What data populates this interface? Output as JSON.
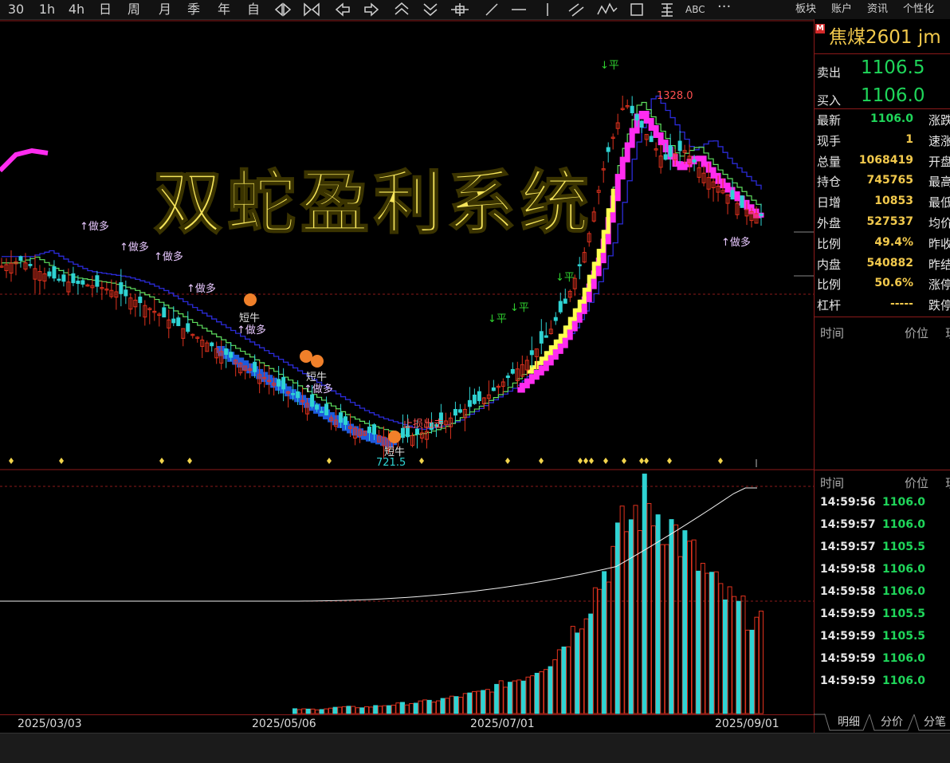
{
  "toolbar": {
    "periods": [
      "30",
      "1h",
      "4h",
      "日",
      "周",
      "月",
      "季",
      "年",
      "自"
    ],
    "tool_icons": [
      "zoom-out-icon",
      "zoom-in-icon",
      "arrow-left-icon",
      "arrow-right-icon",
      "arrow-up-icon",
      "arrow-down-icon",
      "crosshair-icon",
      "trendline-icon",
      "horizontal-line-icon",
      "vertical-line-icon",
      "parallel-line-icon",
      "wave-icon",
      "rectangle-icon",
      "fib-icon"
    ],
    "abc": "ABC",
    "more": "···",
    "menus": [
      "板块",
      "账户",
      "资讯",
      "个性化"
    ]
  },
  "overlay_title": "双蛇盈利系统",
  "annotations": {
    "up_signal": "↑做多",
    "down_signal": "↓平",
    "short_bull": "短牛",
    "peak_label": "1328.0",
    "low_label": "721.5",
    "middle_text": "止损出击"
  },
  "xaxis": {
    "dates": [
      "2025/03/03",
      "2025/05/06",
      "2025/07/01",
      "2025/09/01"
    ]
  },
  "quote": {
    "badge": "M",
    "symbol": "焦煤2601",
    "code": "jm",
    "sell_label": "卖出",
    "sell_value": "1106.5",
    "buy_label": "买入",
    "buy_value": "1106.0",
    "rows": [
      {
        "label": "最新",
        "value": "1106.0",
        "color": "#1fd65a",
        "right": "涨跌"
      },
      {
        "label": "现手",
        "value": "1",
        "color": "#f2c94c",
        "right": "速涨"
      },
      {
        "label": "总量",
        "value": "1068419",
        "color": "#f2c94c",
        "right": "开盘"
      },
      {
        "label": "持仓",
        "value": "745765",
        "color": "#f2c94c",
        "right": "最高"
      },
      {
        "label": "日增",
        "value": "10853",
        "color": "#f2c94c",
        "right": "最低"
      },
      {
        "label": "外盘",
        "value": "527537",
        "color": "#f2c94c",
        "right": "均价"
      },
      {
        "label": "比例",
        "value": "49.4%",
        "color": "#f2c94c",
        "right": "昨收"
      },
      {
        "label": "内盘",
        "value": "540882",
        "color": "#f2c94c",
        "right": "昨结"
      },
      {
        "label": "比例",
        "value": "50.6%",
        "color": "#f2c94c",
        "right": "涨停"
      },
      {
        "label": "杠杆",
        "value": "-----",
        "color": "#f2c94c",
        "right": "跌停"
      }
    ],
    "tick_header_1": {
      "time": "时间",
      "price": "价位",
      "vol": "现"
    },
    "tick_header_2": {
      "time": "时间",
      "price": "价位",
      "vol": "现"
    },
    "ticks": [
      {
        "time": "14:59:56",
        "price": "1106.0"
      },
      {
        "time": "14:59:57",
        "price": "1106.0"
      },
      {
        "time": "14:59:57",
        "price": "1105.5"
      },
      {
        "time": "14:59:58",
        "price": "1106.0"
      },
      {
        "time": "14:59:58",
        "price": "1106.0"
      },
      {
        "time": "14:59:59",
        "price": "1105.5"
      },
      {
        "time": "14:59:59",
        "price": "1105.5"
      },
      {
        "time": "14:59:59",
        "price": "1106.0"
      },
      {
        "time": "14:59:59",
        "price": "1106.0"
      }
    ],
    "tabs": [
      "明细",
      "分价",
      "分笔"
    ]
  },
  "colors": {
    "up": "#e0321e",
    "down": "#2fd3d3",
    "magenta": "#ff2cf0",
    "yellow": "#ffff50",
    "blue": "#1e5adc",
    "green_line": "#5fe05f",
    "navy_line": "#2b2bd8",
    "grid": "#8b1a1a"
  },
  "chart_data": {
    "type": "candlestick",
    "x_start": "2025/02",
    "x_end": "2025/09",
    "price_labels": {
      "high": 1328.0,
      "low": 721.5
    },
    "close_path": [
      1020,
      1030,
      1010,
      995,
      990,
      985,
      975,
      960,
      940,
      920,
      900,
      880,
      860,
      840,
      820,
      800,
      780,
      760,
      745,
      735,
      725,
      730,
      740,
      760,
      780,
      800,
      830,
      860,
      900,
      960,
      1050,
      1200,
      1300,
      1250,
      1200,
      1220,
      1180,
      1150,
      1120,
      1106
    ],
    "volume_relative": [
      0.02,
      0.02,
      0.03,
      0.03,
      0.04,
      0.05,
      0.06,
      0.08,
      0.1,
      0.14,
      0.18,
      0.25,
      0.4,
      0.6,
      0.85,
      1.0,
      0.9,
      0.75,
      0.6,
      0.5,
      0.42
    ]
  }
}
